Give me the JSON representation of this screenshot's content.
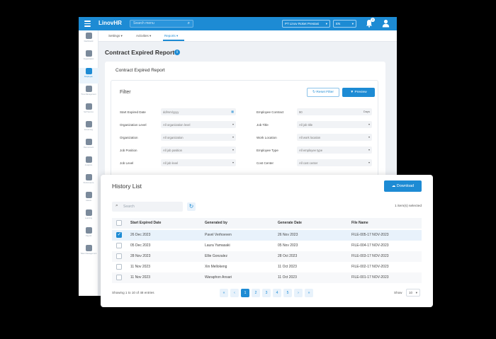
{
  "app": {
    "logo": "LinovHR",
    "search_placeholder": "Search menu",
    "company": "PT Linov Roket Prestasi",
    "language": "EN",
    "notification_count": "3"
  },
  "sidebar": {
    "items": [
      {
        "label": "Dashboard",
        "active": false
      },
      {
        "label": "Organization",
        "active": false
      },
      {
        "label": "Employee",
        "active": true
      },
      {
        "label": "Time Management",
        "active": false
      },
      {
        "label": "Self Service",
        "active": false
      },
      {
        "label": "E-learning",
        "active": false
      },
      {
        "label": "Recruitment",
        "active": false
      },
      {
        "label": "Analytics",
        "active": false
      },
      {
        "label": "Performance",
        "active": false
      },
      {
        "label": "Assets",
        "active": false
      },
      {
        "label": "Learning",
        "active": false
      },
      {
        "label": "Payroll",
        "active": false
      },
      {
        "label": "Talent Management",
        "active": false
      }
    ]
  },
  "subnav": {
    "tabs": [
      {
        "label": "Settings",
        "active": false
      },
      {
        "label": "Activities",
        "active": false
      },
      {
        "label": "Reports",
        "active": true
      }
    ]
  },
  "page": {
    "title": "Contract Expired Report",
    "info_icon": "info-icon"
  },
  "report_card": {
    "title": "Contract Expired Report",
    "filter_title": "Filter",
    "reset_label": "Reset Filter",
    "preview_label": "Preview",
    "left_fields": [
      {
        "label": "Start Expired Date",
        "value": "dd/mm/yyyy"
      },
      {
        "label": "Organization Level",
        "value": "All organization level"
      },
      {
        "label": "Organization",
        "value": "All organization"
      },
      {
        "label": "Job Position",
        "value": "All job position"
      },
      {
        "label": "Job Level",
        "value": "All job level"
      }
    ],
    "right_fields": [
      {
        "label": "Employee Contract",
        "value": "90",
        "suffix": "Days"
      },
      {
        "label": "Job Title",
        "value": "All job title"
      },
      {
        "label": "Work Location",
        "value": "All work location"
      },
      {
        "label": "Employee Type",
        "value": "All employee type"
      },
      {
        "label": "Cost Center",
        "value": "All cost center"
      }
    ]
  },
  "history": {
    "title": "History List",
    "download_label": "Download",
    "search_placeholder": "Search",
    "selected_count": "1 item(s) selected",
    "columns": [
      "Start Expired Date",
      "Generated by",
      "Generate Date",
      "File Name"
    ],
    "rows": [
      {
        "checked": true,
        "start": "26 Dec 2023",
        "by": "Pavel Verhoeven",
        "date": "26 Nov 2023",
        "file": "FILE-005-17 NOV-2023"
      },
      {
        "checked": false,
        "start": "05 Dec 2023",
        "by": "Laura Yamasaki",
        "date": "05 Nov 2023",
        "file": "FILE-004-17 NOV-2023"
      },
      {
        "checked": false,
        "start": "28 Nov 2023",
        "by": "Ellie Gonzalez",
        "date": "28 Oct 2023",
        "file": "FILE-003-17 NOV-2023"
      },
      {
        "checked": false,
        "start": "11 Nov 2023",
        "by": "Xin Mellokeng",
        "date": "11 Oct 2023",
        "file": "FILE-002-17 NOV-2023"
      },
      {
        "checked": false,
        "start": "11 Nov 2023",
        "by": "Waraphon Ansari",
        "date": "11 Oct 2023",
        "file": "FILE-001-17 NOV-2023"
      }
    ],
    "entries_info": "Showing 1 to 10 of 48 entries",
    "pages": [
      "«",
      "‹",
      "1",
      "2",
      "3",
      "4",
      "5",
      "›",
      "»"
    ],
    "active_page": "1",
    "show_label": "Show",
    "page_size": "10"
  },
  "colors": {
    "primary": "#1d8bd4",
    "selected_row": "#e8f2fb"
  }
}
